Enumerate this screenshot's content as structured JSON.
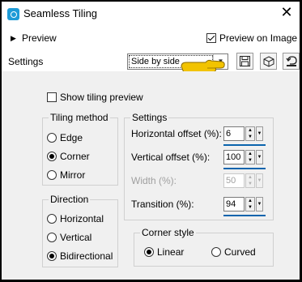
{
  "window": {
    "title": "Seamless Tiling",
    "close_glyph": "✕"
  },
  "top": {
    "preview_label": "Preview",
    "preview_on_image_label": "Preview on Image",
    "preview_on_image_checked": true,
    "settings_label": "Settings",
    "preset_value": "Side by side"
  },
  "toolbar": {
    "icons": [
      "save-icon",
      "cube-icon",
      "reset-icon"
    ]
  },
  "main": {
    "show_tiling_preview_label": "Show tiling preview",
    "show_tiling_preview_checked": false,
    "tiling_method": {
      "title": "Tiling method",
      "options": [
        "Edge",
        "Corner",
        "Mirror"
      ],
      "selected": "Corner"
    },
    "direction": {
      "title": "Direction",
      "options": [
        "Horizontal",
        "Vertical",
        "Bidirectional"
      ],
      "selected": "Bidirectional"
    },
    "settings": {
      "title": "Settings",
      "horizontal_offset_label": "Horizontal offset (%):",
      "horizontal_offset_value": "6",
      "vertical_offset_label": "Vertical offset (%):",
      "vertical_offset_value": "100",
      "width_label": "Width (%):",
      "width_value": "50",
      "transition_label": "Transition (%):",
      "transition_value": "94"
    },
    "corner_style": {
      "title": "Corner style",
      "options": [
        "Linear",
        "Curved"
      ],
      "selected": "Linear"
    }
  },
  "colors": {
    "accent": "#0a64ad",
    "pointer": "#f2c300",
    "app_icon": "#1e9bd7"
  }
}
